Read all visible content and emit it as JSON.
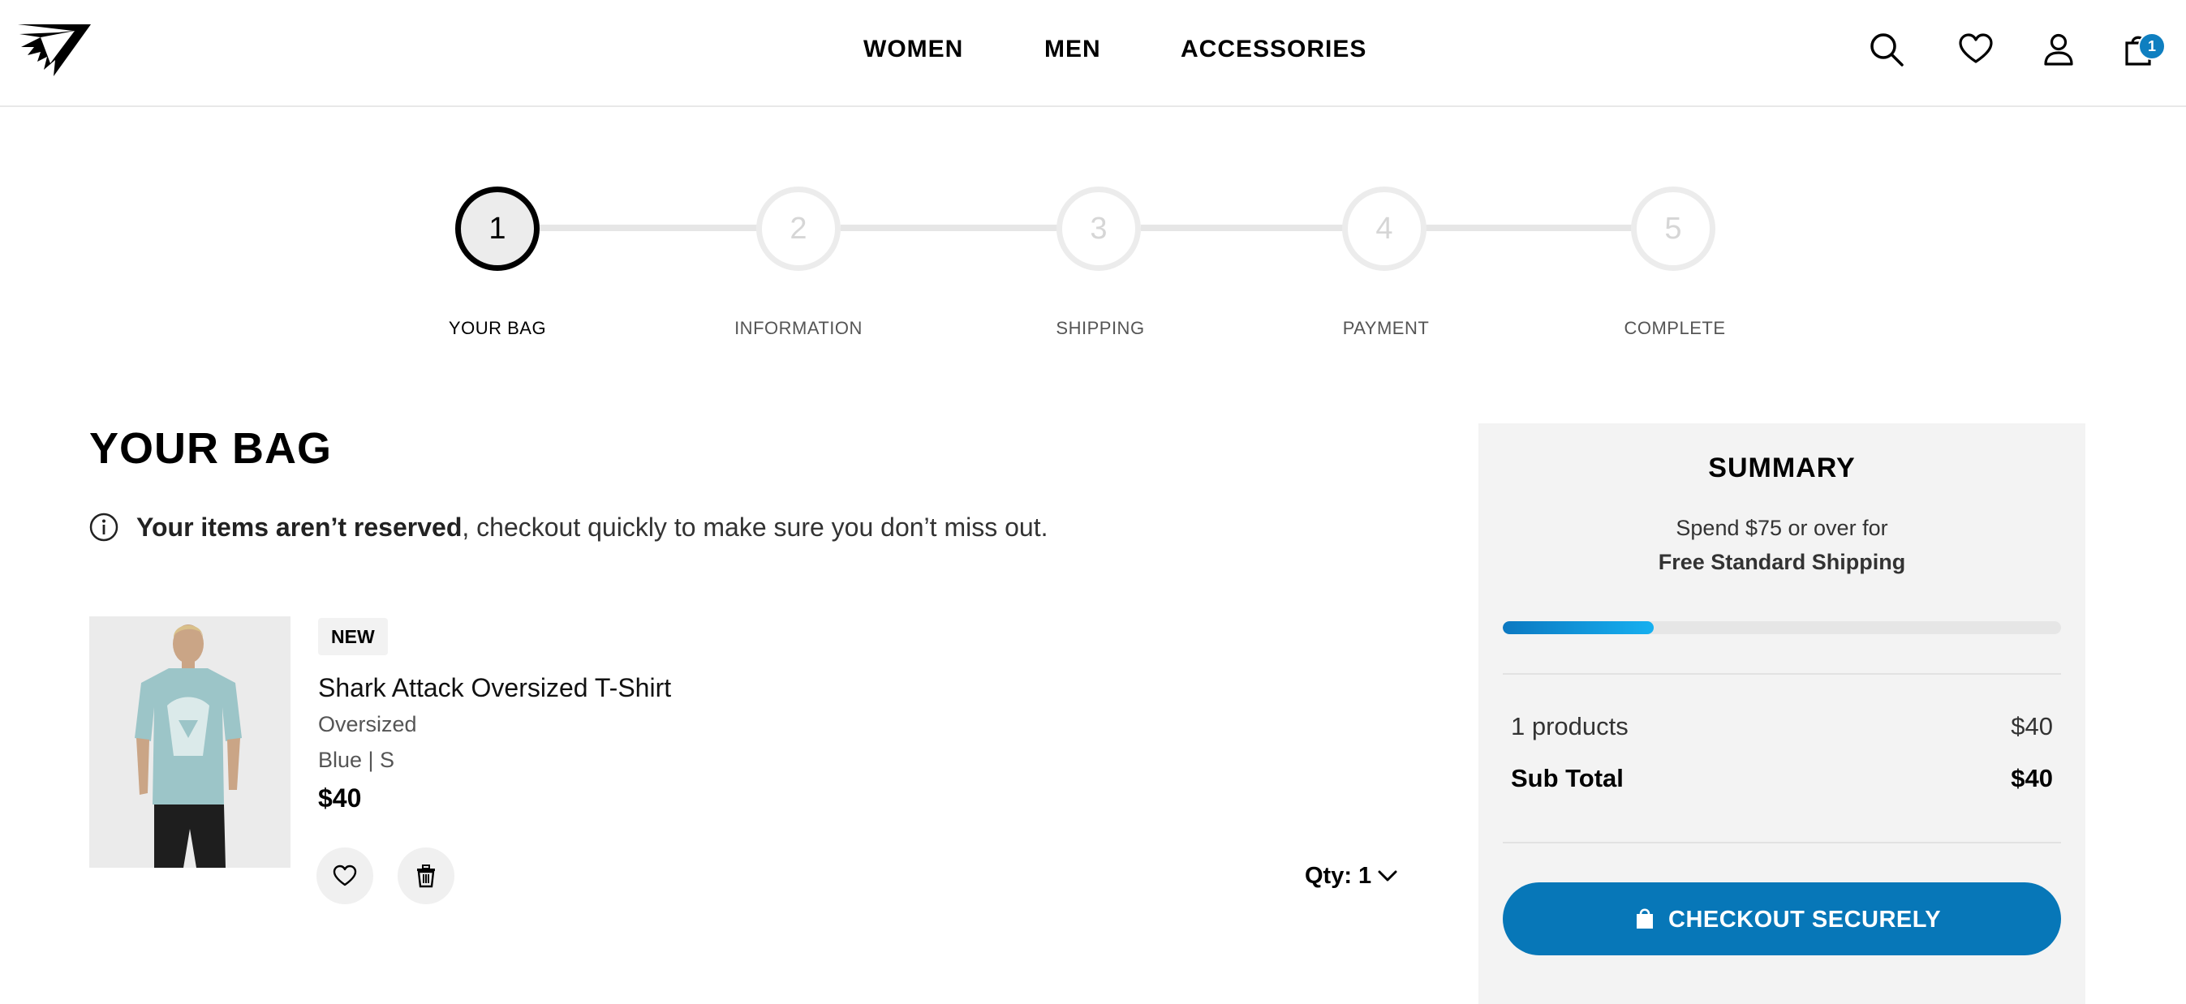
{
  "header": {
    "nav": [
      "WOMEN",
      "MEN",
      "ACCESSORIES"
    ],
    "cart_count": "1",
    "icons": [
      "search-icon",
      "heart-icon",
      "user-icon",
      "bag-icon"
    ]
  },
  "stepper": {
    "current": 1,
    "steps": [
      {
        "number": "1",
        "label": "YOUR BAG"
      },
      {
        "number": "2",
        "label": "INFORMATION"
      },
      {
        "number": "3",
        "label": "SHIPPING"
      },
      {
        "number": "4",
        "label": "PAYMENT"
      },
      {
        "number": "5",
        "label": "COMPLETE"
      }
    ]
  },
  "bag": {
    "title": "YOUR BAG",
    "notice_bold": "Your items aren’t reserved",
    "notice_rest": ", checkout quickly to make sure you don’t miss out.",
    "item": {
      "badge": "NEW",
      "name": "Shark Attack Oversized T-Shirt",
      "fit": "Oversized",
      "variant": "Blue | S",
      "price": "$40",
      "qty_label": "Qty: 1"
    }
  },
  "summary": {
    "title": "SUMMARY",
    "spend_text": "Spend $75 or over for",
    "free_text": "Free Standard Shipping",
    "progress": 0.27,
    "products_label": "1 products",
    "products_value": "$40",
    "subtotal_label": "Sub Total",
    "subtotal_value": "$40",
    "checkout_label": "CHECKOUT SECURELY"
  },
  "colors": {
    "accent": "#0777b8",
    "badge": "#0f7fc0",
    "step_active_border": "#000000",
    "step_inactive": "#ececec"
  }
}
